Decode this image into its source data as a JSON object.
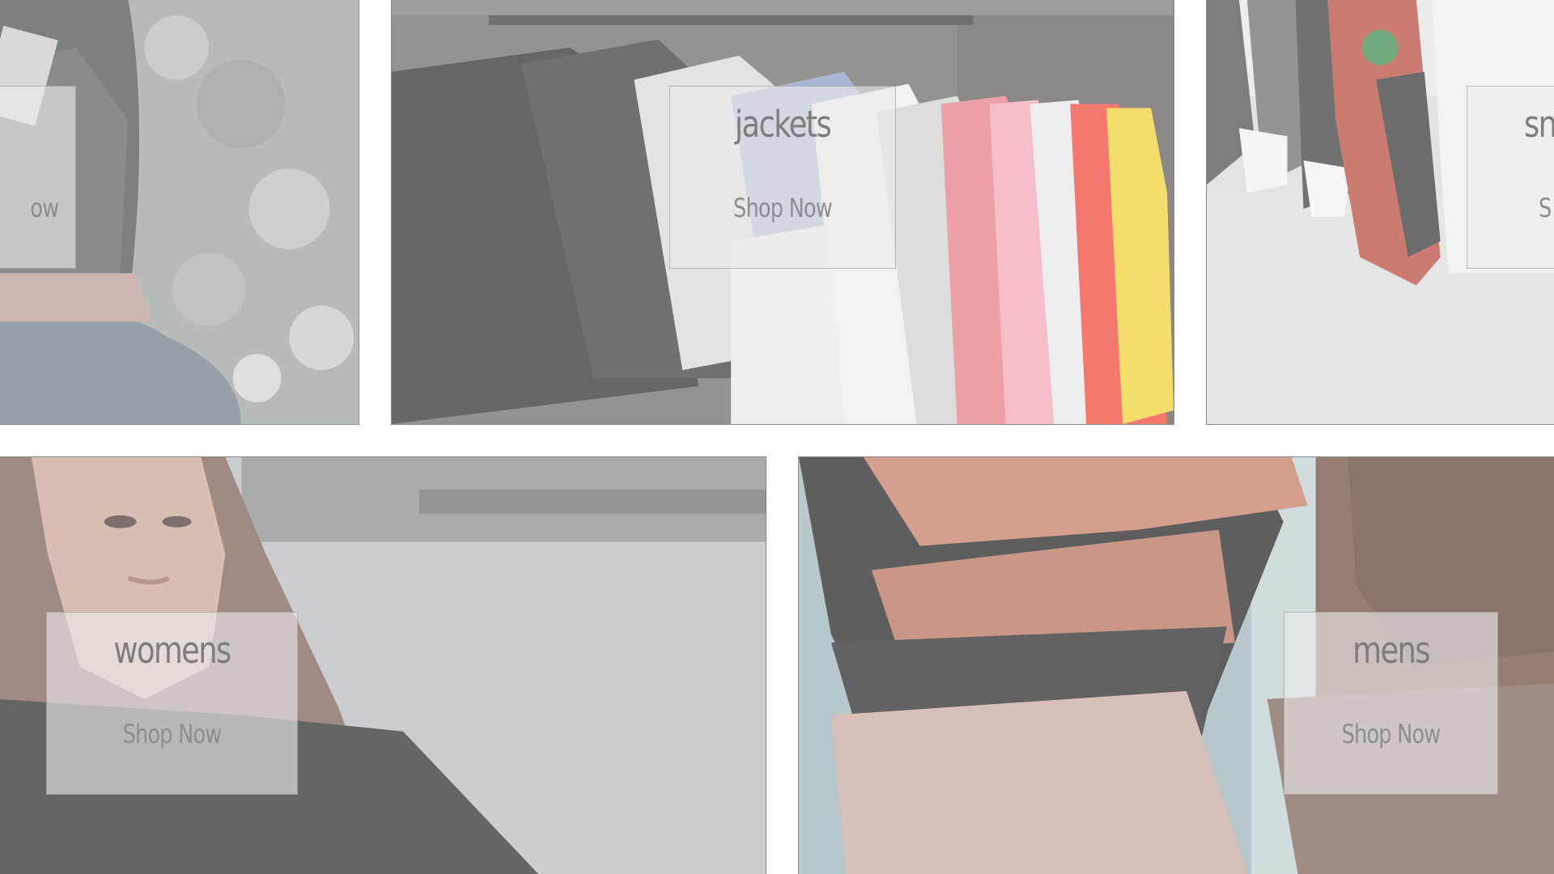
{
  "categories": [
    {
      "id": "hats",
      "label": "",
      "cta": "Shop Now",
      "cta_visible_fragment": "ow"
    },
    {
      "id": "jackets",
      "label": "jackets",
      "cta": "Shop Now"
    },
    {
      "id": "sneakers",
      "label_fragment": "sn",
      "cta_fragment": "S"
    },
    {
      "id": "womens",
      "label": "womens",
      "cta": "Shop Now"
    },
    {
      "id": "mens",
      "label": "mens",
      "cta": "Shop Now"
    }
  ]
}
